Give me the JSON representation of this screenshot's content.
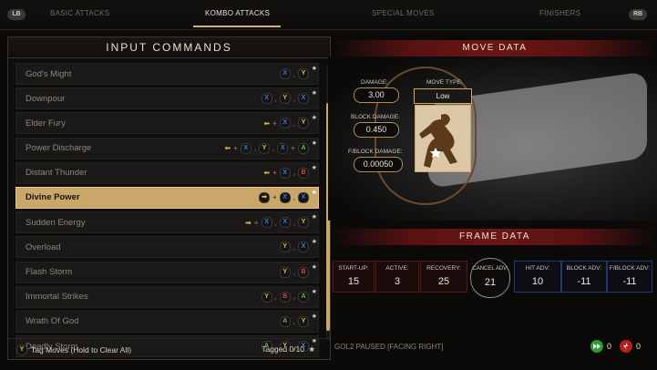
{
  "nav": {
    "left_button": "LB",
    "right_button": "RB",
    "tabs": [
      {
        "label": "BASIC ATTACKS",
        "active": false
      },
      {
        "label": "KOMBO ATTACKS",
        "active": true
      },
      {
        "label": "SPECIAL MOVES",
        "active": false
      },
      {
        "label": "FINISHERS",
        "active": false
      }
    ]
  },
  "input_commands": {
    "title": "INPUT COMMANDS",
    "rows": [
      {
        "name": "God's Might",
        "selected": false
      },
      {
        "name": "Downpour",
        "selected": false
      },
      {
        "name": "Elder Fury",
        "selected": false
      },
      {
        "name": "Power Discharge",
        "selected": false
      },
      {
        "name": "Distant Thunder",
        "selected": false
      },
      {
        "name": "Divine Power",
        "selected": true
      },
      {
        "name": "Sudden Energy",
        "selected": false
      },
      {
        "name": "Overload",
        "selected": false
      },
      {
        "name": "Flash Storm",
        "selected": false
      },
      {
        "name": "Immortal Strikes",
        "selected": false
      },
      {
        "name": "Wrath Of God",
        "selected": false
      },
      {
        "name": "Deadly Storm",
        "selected": false
      }
    ],
    "button_colors": {
      "X": "#3b7be0",
      "Y": "#e0c13a",
      "B": "#d9463a",
      "A": "#5fbf3a"
    },
    "footer": {
      "tag_button": "Y",
      "tag_label": "Tag Moves (Hold to Clear All)",
      "tagged": "Tagged 0/10"
    }
  },
  "move_data": {
    "title": "MOVE DATA",
    "damage_label": "DAMAGE:",
    "damage": "3.00",
    "block_damage_label": "BLOCK DAMAGE:",
    "block_damage": "0.450",
    "fblock_damage_label": "F/BLOCK DAMAGE:",
    "fblock_damage": "0.00050",
    "move_type_label": "MOVE TYPE:",
    "move_type": "Low"
  },
  "frame_data": {
    "title": "FRAME DATA",
    "startup_label": "START-UP:",
    "startup": "15",
    "active_label": "ACTIVE:",
    "active": "3",
    "recovery_label": "RECOVERY:",
    "recovery": "25",
    "cancel_label": "CANCEL ADV:",
    "cancel": "21",
    "hit_label": "HIT ADV:",
    "hit": "10",
    "block_label": "BLOCK ADV:",
    "block": "-11",
    "fblock_label": "F/BLOCK ADV:",
    "fblock": "-11"
  },
  "status": "GOL2 PAUSED [FACING RIGHT]",
  "counters": {
    "green": "0",
    "red": "0"
  }
}
